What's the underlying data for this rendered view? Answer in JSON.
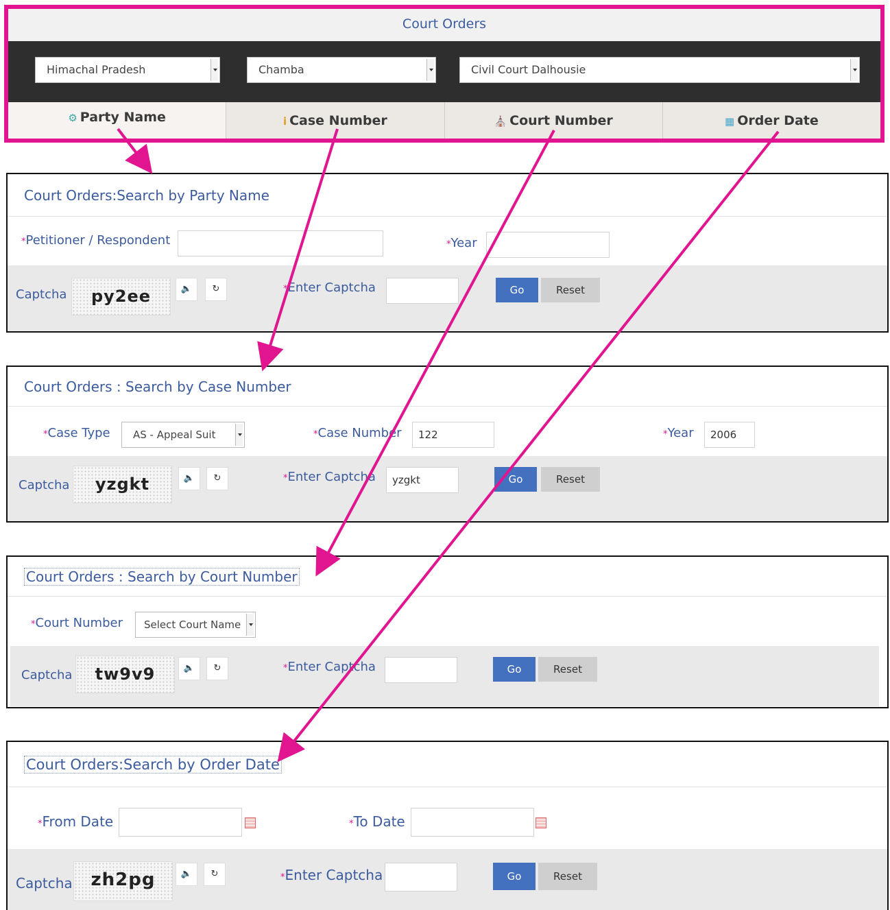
{
  "top": {
    "title": "Court Orders",
    "state_select": "Himachal Pradesh",
    "district_select": "Chamba",
    "court_complex_select": "Civil Court Dalhousie",
    "tabs": [
      {
        "label": "Party Name",
        "icon": "users-icon"
      },
      {
        "label": "Case Number",
        "icon": "info-icon"
      },
      {
        "label": "Court Number",
        "icon": "bank-icon"
      },
      {
        "label": "Order Date",
        "icon": "calendar-icon"
      }
    ]
  },
  "party": {
    "title": "Court Orders:Search by Party Name",
    "petitioner_label": "Petitioner / Respondent",
    "petitioner_value": "",
    "year_label": "Year",
    "year_value": "",
    "captcha_label": "Captcha",
    "captcha_text": "py2ee",
    "enter_captcha_label": "Enter Captcha",
    "captcha_value": "",
    "go": "Go",
    "reset": "Reset"
  },
  "casenum": {
    "title": "Court Orders : Search by Case Number",
    "case_type_label": "Case Type",
    "case_type_value": "AS - Appeal Suit",
    "case_number_label": "Case Number",
    "case_number_value": "122",
    "year_label": "Year",
    "year_value": "2006",
    "captcha_label": "Captcha",
    "captcha_text": "yzgkt",
    "enter_captcha_label": "Enter Captcha",
    "captcha_value": "yzgkt",
    "go": "Go",
    "reset": "Reset"
  },
  "courtnum": {
    "title": "Court Orders : Search by Court Number",
    "court_number_label": "Court Number",
    "court_number_value": "Select Court Name",
    "captcha_label": "Captcha",
    "captcha_text": "tw9v9",
    "enter_captcha_label": "Enter Captcha",
    "captcha_value": "",
    "go": "Go",
    "reset": "Reset"
  },
  "orderdate": {
    "title": "Court Orders:Search by Order Date",
    "from_label": "From Date",
    "from_value": "",
    "to_label": "To Date",
    "to_value": "",
    "captcha_label": "Captcha",
    "captcha_text": "zh2pg",
    "enter_captcha_label": "Enter Captcha",
    "captcha_value": "",
    "go": "Go",
    "reset": "Reset"
  },
  "required_mark": "*",
  "icons": {
    "audio": "speaker-icon",
    "refresh": "refresh-icon",
    "calendar": "calendar-icon"
  },
  "colors": {
    "highlight": "#e0158f",
    "label": "#3b5b9e",
    "go_button": "#4470c0",
    "select_bar": "#2e2e2e"
  }
}
